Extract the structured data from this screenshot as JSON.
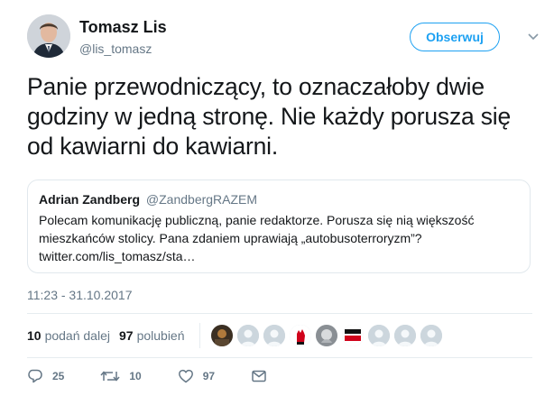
{
  "author": {
    "name": "Tomasz Lis",
    "handle": "@lis_tomasz",
    "follow_label": "Obserwuj"
  },
  "tweet": {
    "text": "Panie przewodniczący, to oznaczałoby dwie godziny w jedną stronę. Nie każdy porusza się od kawiarni do kawiarni.",
    "timestamp": "11:23 - 31.10.2017"
  },
  "quoted": {
    "name": "Adrian Zandberg",
    "handle": "@ZandbergRAZEM",
    "text": "Polecam komunikację publiczną, panie redaktorze. Porusza się nią większość mieszkańców stolicy. Pana zdaniem uprawiają „autobusoterroryzm”? twitter.com/lis_tomasz/sta…"
  },
  "stats": {
    "retweets_count": "10",
    "retweets_label": "podań dalej",
    "likes_count": "97",
    "likes_label": "polubień",
    "liker_avatars": [
      "photo-avatar",
      "default-egg-avatar",
      "default-egg-avatar",
      "fist-logo-avatar",
      "photo-avatar",
      "text-logo-avatar",
      "default-egg-avatar",
      "default-egg-avatar",
      "default-egg-avatar"
    ]
  },
  "actions": {
    "reply_count": "25",
    "retweet_count": "10",
    "like_count": "97"
  },
  "colors": {
    "accent": "#1da1f2",
    "secondary_text": "#657786",
    "border": "#e1e8ed"
  }
}
